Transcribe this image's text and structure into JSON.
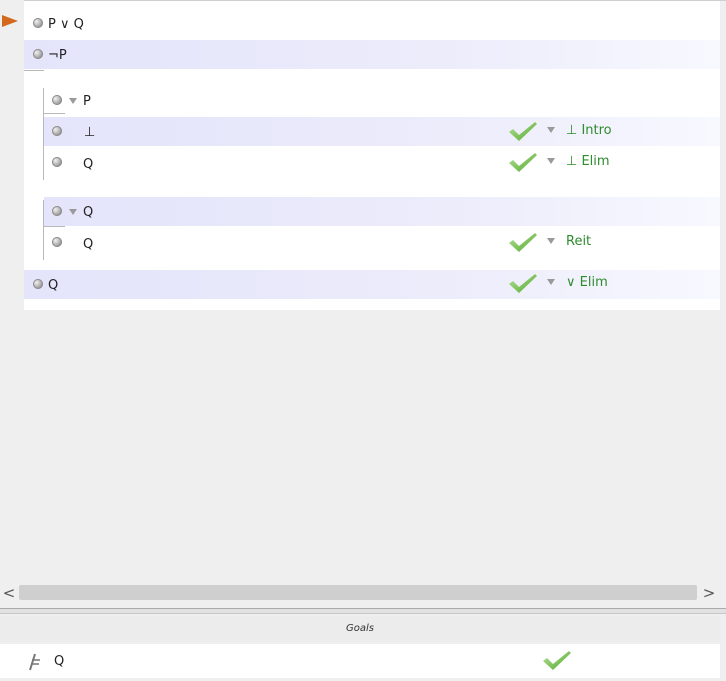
{
  "proof": {
    "premises": [
      {
        "formula": "P ∨ Q"
      },
      {
        "formula": "¬P"
      }
    ],
    "subproof1": {
      "assumption": "P",
      "steps": [
        {
          "formula": "⊥",
          "rule": "⊥ Intro"
        },
        {
          "formula": "Q",
          "rule": "⊥ Elim"
        }
      ]
    },
    "subproof2": {
      "assumption": "Q",
      "steps": [
        {
          "formula": "Q",
          "rule": "Reit"
        }
      ]
    },
    "conclusion": {
      "formula": "Q",
      "rule": "∨ Elim"
    }
  },
  "scrollbar": {
    "left_arrow": "<",
    "right_arrow": ">"
  },
  "goals": {
    "header": "Goals",
    "items": [
      {
        "formula": "Q"
      }
    ]
  },
  "colors": {
    "rule_text": "#2e8b2e",
    "check": "#6cbf3b",
    "cursor": "#d2691e",
    "highlight": "#e4e4fb"
  }
}
